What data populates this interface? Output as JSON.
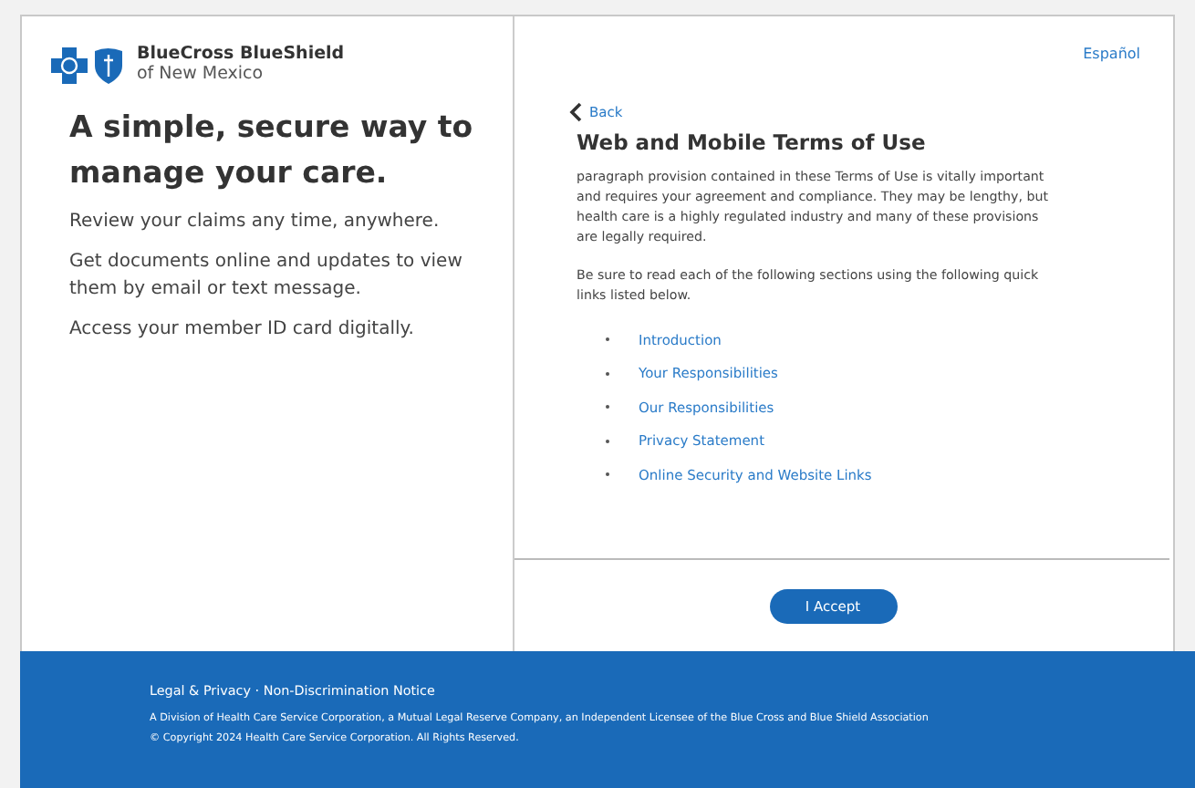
{
  "brand": {
    "name": "BlueCross BlueShield",
    "region": "of New Mexico"
  },
  "promo": {
    "heading": "A simple, secure way to manage your care.",
    "points": [
      "Review your claims any time, anywhere.",
      "Get documents online and updates to view them by email or text message.",
      "Access your member ID card digitally."
    ]
  },
  "language_link": "Español",
  "back_link": "Back",
  "terms": {
    "title": "Web and Mobile Terms of Use",
    "paragraphs": [
      "paragraph provision contained in these Terms of Use is vitally important and requires your agreement and compliance. They may be lengthy, but health care is a highly regulated industry and many of these provisions are legally required.",
      "Be sure to read each of the following sections using the following quick links listed below."
    ],
    "links": [
      "Introduction",
      "Your Responsibilities",
      "Our Responsibilities",
      "Privacy Statement",
      "Online Security and Website Links"
    ]
  },
  "accept_button": "I Accept",
  "footer": {
    "links": [
      "Legal & Privacy",
      "Non-Discrimination Notice"
    ],
    "separator": "·",
    "lines": [
      "A Division of Health Care Service Corporation, a Mutual Legal Reserve Company, an Independent Licensee of the Blue Cross and Blue Shield Association",
      "© Copyright 2024 Health Care Service Corporation. All Rights Reserved."
    ]
  }
}
